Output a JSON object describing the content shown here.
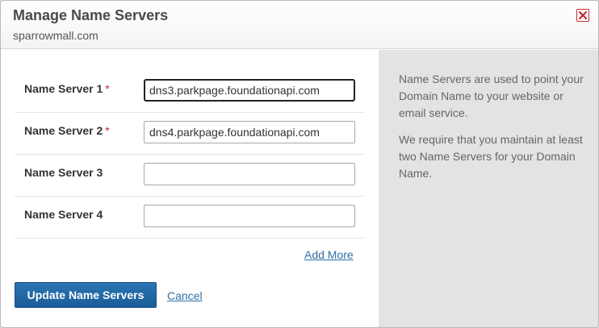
{
  "dialog": {
    "title": "Manage Name Servers",
    "domain": "sparrowmall.com"
  },
  "form": {
    "rows": [
      {
        "label": "Name Server 1",
        "required": "*",
        "value": "dns3.parkpage.foundationapi.com"
      },
      {
        "label": "Name Server 2",
        "required": "*",
        "value": "dns4.parkpage.foundationapi.com"
      },
      {
        "label": "Name Server 3",
        "required": "",
        "value": ""
      },
      {
        "label": "Name Server 4",
        "required": "",
        "value": ""
      }
    ],
    "add_more_label": "Add More",
    "update_label": "Update Name Servers",
    "cancel_label": "Cancel"
  },
  "info": {
    "paragraph_1": "Name Servers are used to point your Domain Name to your website or email service.",
    "paragraph_2": "We require that you maintain at least two Name Servers for your Domain Name."
  },
  "icons": {
    "close": "close-icon"
  },
  "colors": {
    "accent": "#1f64a3",
    "link": "#2f6fa5",
    "required": "#c8262e",
    "close": "#c8262e",
    "side_panel_bg": "#e3e3e3"
  }
}
